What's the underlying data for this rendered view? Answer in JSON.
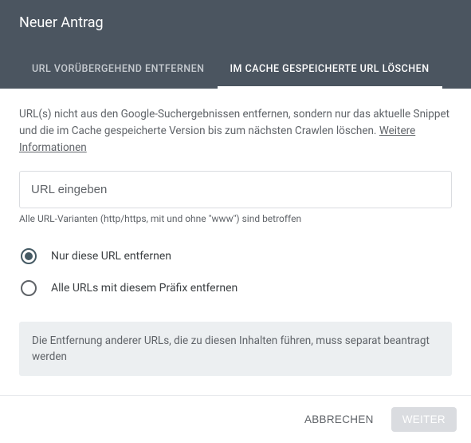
{
  "header": {
    "title": "Neuer Antrag"
  },
  "tabs": [
    {
      "label": "URL vorübergehend entfernen",
      "active": false
    },
    {
      "label": "Im Cache gespeicherte URL löschen",
      "active": true
    }
  ],
  "description": {
    "text": "URL(s) nicht aus den Google-Suchergebnissen entfernen, sondern nur das aktuelle Snippet und die im Cache gespeicherte Version bis zum nächsten Crawlen löschen. ",
    "link": "Weitere Informationen"
  },
  "url_input": {
    "placeholder": "URL eingeben",
    "value": ""
  },
  "hint": "Alle URL-Varianten (http/https, mit und ohne \"www\") sind betroffen",
  "radios": [
    {
      "label": "Nur diese URL entfernen",
      "checked": true
    },
    {
      "label": "Alle URLs mit diesem Präfix entfernen",
      "checked": false
    }
  ],
  "note": "Die Entfernung anderer URLs, die zu diesen Inhalten führen, muss separat beantragt werden",
  "footer": {
    "cancel": "Abbrechen",
    "next": "Weiter"
  }
}
